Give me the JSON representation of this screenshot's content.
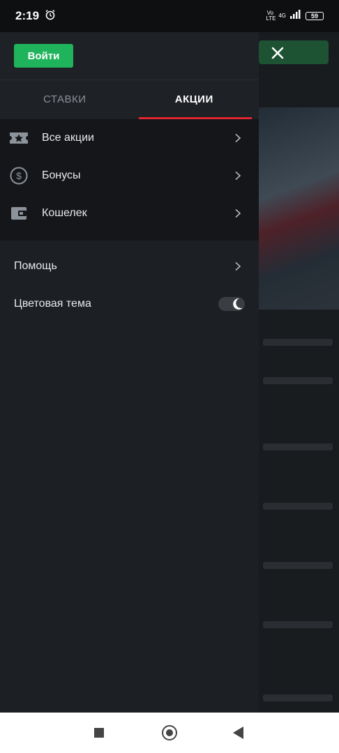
{
  "status_bar": {
    "time": "2:19",
    "volte": "Vo LTE",
    "network": "4G",
    "battery": "59"
  },
  "drawer": {
    "login_label": "Войти",
    "tabs": [
      {
        "label": "СТАВКИ",
        "active": false
      },
      {
        "label": "АКЦИИ",
        "active": true
      }
    ],
    "promo_items": [
      {
        "label": "Все акции",
        "icon": "ticket-star-icon"
      },
      {
        "label": "Бонусы",
        "icon": "dollar-coin-icon"
      },
      {
        "label": "Кошелек",
        "icon": "wallet-icon"
      }
    ],
    "help_label": "Помощь",
    "theme_label": "Цветовая тема",
    "theme_toggle_icon": "moon-icon"
  },
  "colors": {
    "accent_green": "#1fb35b",
    "tab_indicator_red": "#e0262f",
    "drawer_bg": "#1c1f23"
  }
}
